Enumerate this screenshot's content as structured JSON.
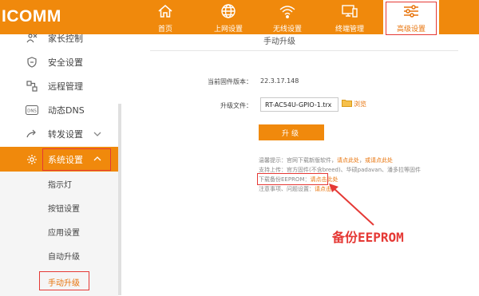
{
  "brand": {
    "logo": "ICOMM"
  },
  "nav": [
    {
      "label": "首页",
      "icon": "home-icon"
    },
    {
      "label": "上网设置",
      "icon": "globe-icon"
    },
    {
      "label": "无线设置",
      "icon": "wifi-icon"
    },
    {
      "label": "终端管理",
      "icon": "devices-icon"
    },
    {
      "label": "高级设置",
      "icon": "sliders-icon",
      "active": true
    }
  ],
  "sidebar": {
    "items": [
      {
        "label": "家长控制",
        "icon": "parental-icon"
      },
      {
        "label": "安全设置",
        "icon": "shield-icon"
      },
      {
        "label": "远程管理",
        "icon": "remote-icon"
      },
      {
        "label": "动态DNS",
        "icon": "dns-icon"
      },
      {
        "label": "转发设置",
        "icon": "forward-icon"
      },
      {
        "label": "系统设置",
        "icon": "gear-icon",
        "active": true
      }
    ],
    "subitems": [
      "指示灯",
      "按钮设置",
      "应用设置",
      "自动升级",
      "手动升级"
    ]
  },
  "main": {
    "title": "手动升级",
    "current_fw_label": "当前固件版本：",
    "current_fw_value": "22.3.17.148",
    "upgrade_file_label": "升级文件：",
    "upgrade_file_value": "RT-AC54U-GPIO-1.trx",
    "browse_label": "浏览",
    "upgrade_button": "升级",
    "tips": {
      "line1_text": "温馨提示：官网下载新版软件，",
      "line1_link1": "请点此处",
      "line1_sep": "，",
      "line1_link2": "或请点此处",
      "line2_text": "支持上传：官方固件(不含breed)、华硕padavan、潘多拉等固件",
      "line3_text": "下载备份EEPROM：",
      "line3_link": "请点击此处",
      "line4_text": "注意事项、问题设置：",
      "line4_link": "请点击"
    }
  },
  "annotation": {
    "text": "备份EEPROM"
  },
  "colors": {
    "accent": "#f0890c",
    "highlight_red": "#e53935",
    "link": "#e8740c"
  }
}
